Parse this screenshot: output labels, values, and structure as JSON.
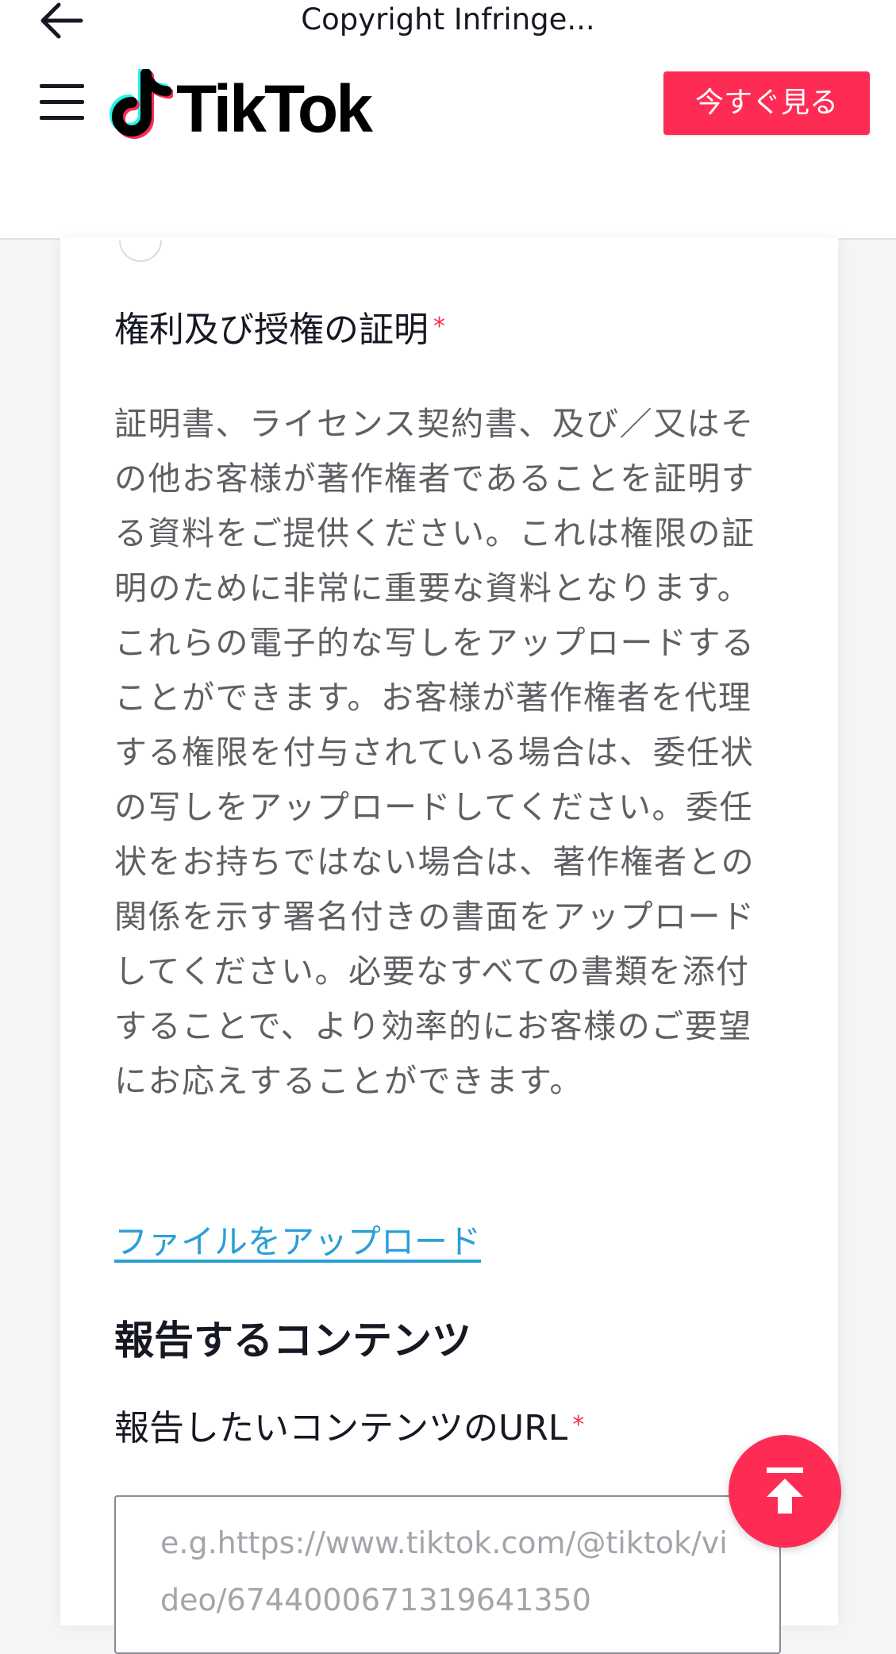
{
  "topbar": {
    "title": "Copyright Infringe...",
    "back_icon": "arrow-left-icon"
  },
  "header": {
    "menu_icon": "hamburger-icon",
    "logo_text": "TikTok",
    "watch_button_label": "今すぐ見る",
    "colors": {
      "accent": "#fe2c55",
      "logo_cyan": "#25f4ee"
    }
  },
  "form": {
    "proof_label": "権利及び授権の証明",
    "required_mark": "*",
    "proof_description": "証明書、ライセンス契約書、及び／又はその他お客様が著作権者であることを証明する資料をご提供ください。これは権限の証明のために非常に重要な資料となります。これらの電子的な写しをアップロードすることができます。お客様が著作権者を代理する権限を付与されている場合は、委任状の写しをアップロードしてください。委任状をお持ちではない場合は、著作権者との関係を示す署名付きの書面をアップロードしてください。必要なすべての書類を添付することで、より効率的にお客様のご要望にお応えすることができます。",
    "upload_link": "ファイルをアップロード",
    "content_heading": "報告するコンテンツ",
    "url_label": "報告したいコンテンツのURL",
    "url_placeholder": "e.g.https://www.tiktok.com/@tiktok/video/6744000671319641350"
  },
  "scroll_top_icon": "arrow-up-to-top-icon"
}
